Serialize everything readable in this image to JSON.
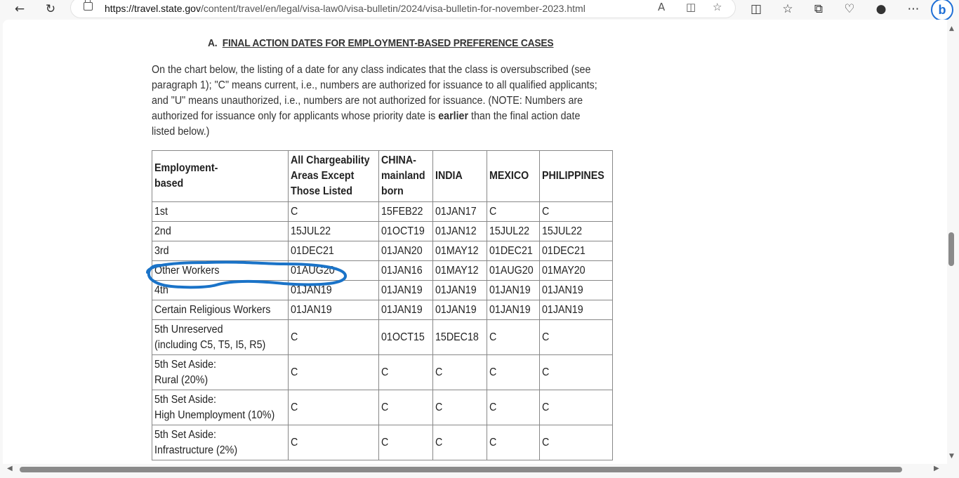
{
  "browser": {
    "url_host": "https://travel.state.gov",
    "url_path": "/content/travel/en/legal/visa-law0/visa-bulletin/2024/visa-bulletin-for-november-2023.html",
    "bing_label": "b"
  },
  "section": {
    "heading_prefix": "A.",
    "heading_title": "FINAL ACTION DATES FOR EMPLOYMENT-BASED PREFERENCE CASES",
    "para_before_bold": "On the chart below, the listing of a date for any class indicates that the class is oversubscribed (see paragraph 1); \"C\" means current, i.e., numbers are authorized for issuance to all qualified applicants; and \"U\" means unauthorized, i.e., numbers are not authorized for issuance. (NOTE: Numbers are authorized for issuance only for applicants whose priority date is ",
    "para_bold": "earlier",
    "para_after_bold": " than the final action date listed below.)"
  },
  "table": {
    "headers": {
      "col0_line1": "Employment-",
      "col0_line2": "based",
      "col1_line1": "All Chargeability",
      "col1_line2": "Areas Except",
      "col1_line3": "Those Listed",
      "col2_line1": "CHINA-",
      "col2_line2": "mainland",
      "col2_line3": "born",
      "col3": "INDIA",
      "col4": "MEXICO",
      "col5": "PHILIPPINES"
    },
    "rows": [
      {
        "label": "1st",
        "label2": "",
        "c1": "C",
        "c2": "15FEB22",
        "c3": "01JAN17",
        "c4": "C",
        "c5": "C"
      },
      {
        "label": "2nd",
        "label2": "",
        "c1": "15JUL22",
        "c2": "01OCT19",
        "c3": "01JAN12",
        "c4": "15JUL22",
        "c5": "15JUL22"
      },
      {
        "label": "3rd",
        "label2": "",
        "c1": "01DEC21",
        "c2": "01JAN20",
        "c3": "01MAY12",
        "c4": "01DEC21",
        "c5": "01DEC21"
      },
      {
        "label": "Other Workers",
        "label2": "",
        "c1": "01AUG20",
        "c2": "01JAN16",
        "c3": "01MAY12",
        "c4": "01AUG20",
        "c5": "01MAY20"
      },
      {
        "label": "4th",
        "label2": "",
        "c1": "01JAN19",
        "c2": "01JAN19",
        "c3": "01JAN19",
        "c4": "01JAN19",
        "c5": "01JAN19"
      },
      {
        "label": "Certain Religious Workers",
        "label2": "",
        "c1": "01JAN19",
        "c2": "01JAN19",
        "c3": "01JAN19",
        "c4": "01JAN19",
        "c5": "01JAN19"
      },
      {
        "label": "5th Unreserved",
        "label2": "(including C5, T5, I5, R5)",
        "c1": "C",
        "c2": "01OCT15",
        "c3": "15DEC18",
        "c4": "C",
        "c5": "C"
      },
      {
        "label": "5th Set Aside:",
        "label2": "Rural (20%)",
        "c1": "C",
        "c2": "C",
        "c3": "C",
        "c4": "C",
        "c5": "C"
      },
      {
        "label": "5th Set Aside:",
        "label2": "High Unemployment (10%)",
        "c1": "C",
        "c2": "C",
        "c3": "C",
        "c4": "C",
        "c5": "C"
      },
      {
        "label": "5th Set Aside:",
        "label2": "Infrastructure (2%)",
        "c1": "C",
        "c2": "C",
        "c3": "C",
        "c4": "C",
        "c5": "C"
      }
    ]
  },
  "annotation": {
    "ink_color": "#1a73c8"
  }
}
